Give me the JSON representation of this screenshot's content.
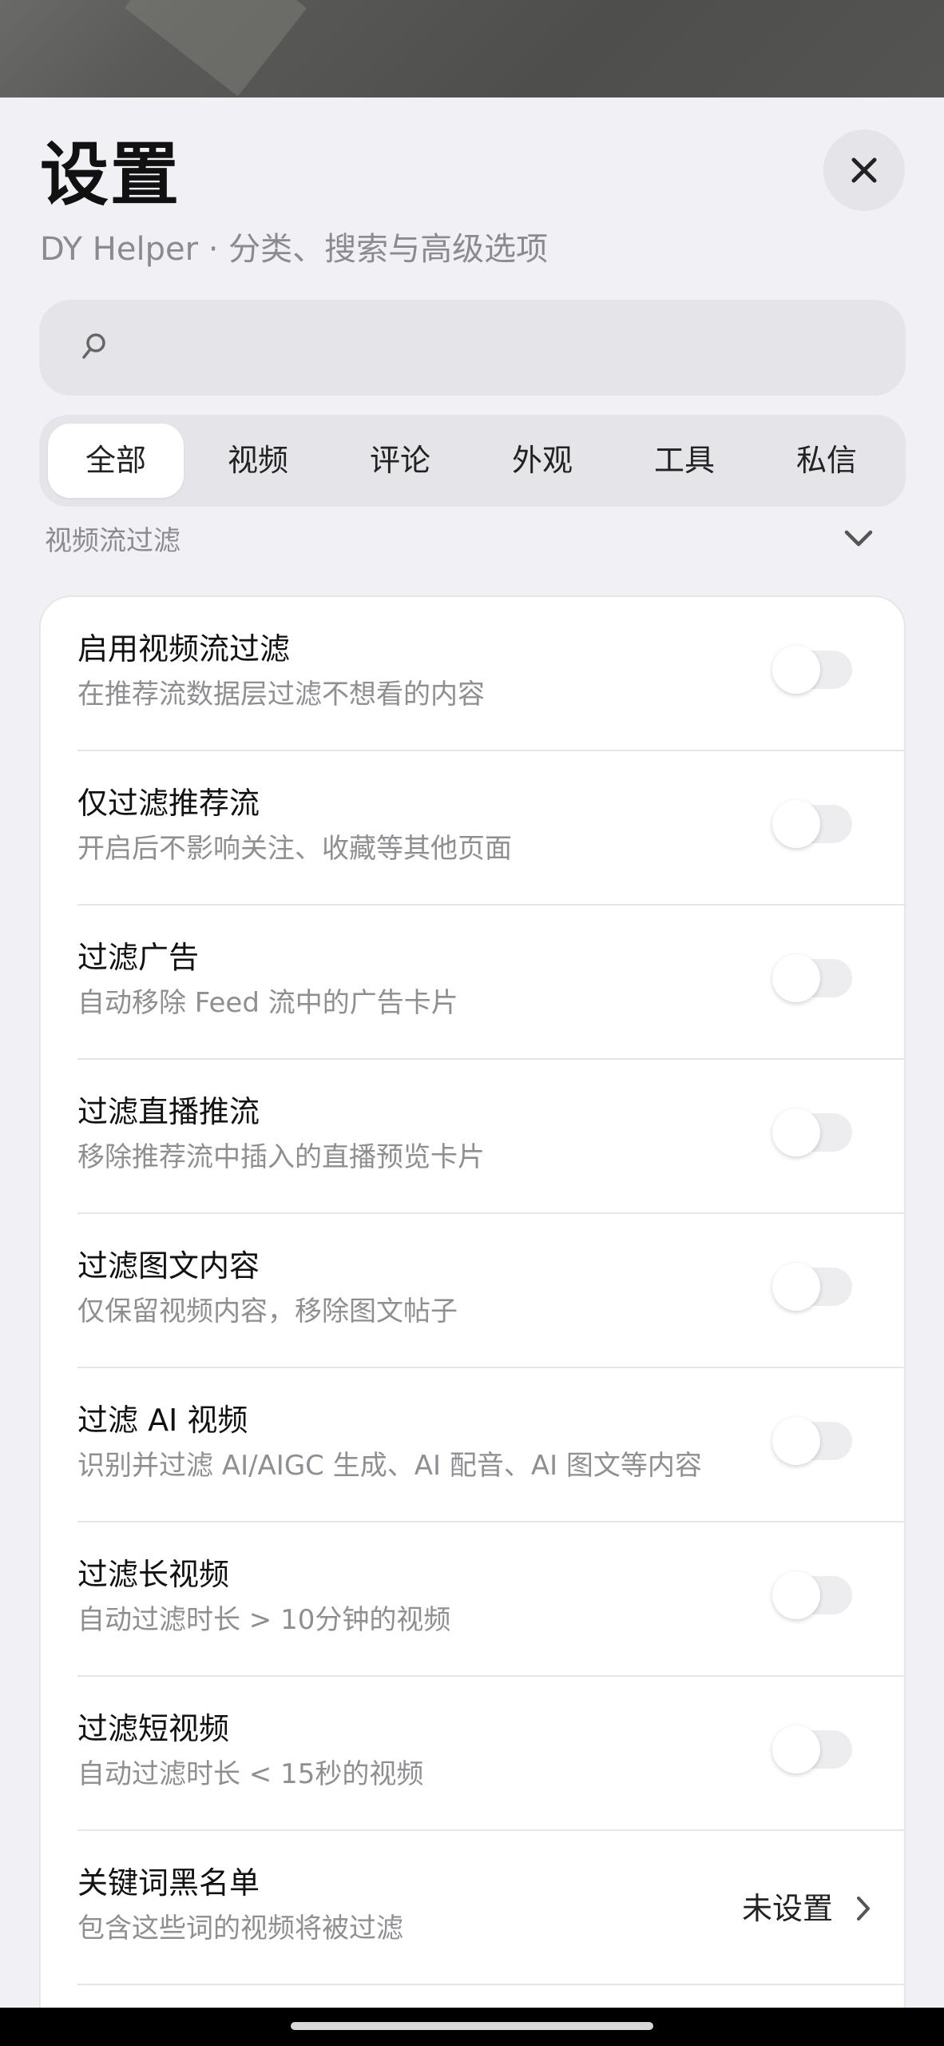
{
  "header": {
    "title": "设置",
    "subtitle": "DY Helper · 分类、搜索与高级选项",
    "close_icon": "close-icon"
  },
  "search": {
    "placeholder": "",
    "value": "",
    "icon": "search-icon"
  },
  "tabs": [
    {
      "label": "全部",
      "active": true
    },
    {
      "label": "视频",
      "active": false
    },
    {
      "label": "评论",
      "active": false
    },
    {
      "label": "外观",
      "active": false
    },
    {
      "label": "工具",
      "active": false
    },
    {
      "label": "私信",
      "active": false
    }
  ],
  "section": {
    "title": "视频流过滤",
    "expanded": true
  },
  "settings": [
    {
      "title": "启用视频流过滤",
      "desc": "在推荐流数据层过滤不想看的内容",
      "enabled": false
    },
    {
      "title": "仅过滤推荐流",
      "desc": "开启后不影响关注、收藏等其他页面",
      "enabled": false
    },
    {
      "title": "过滤广告",
      "desc": "自动移除 Feed 流中的广告卡片",
      "enabled": false
    },
    {
      "title": "过滤直播推流",
      "desc": "移除推荐流中插入的直播预览卡片",
      "enabled": false
    },
    {
      "title": "过滤图文内容",
      "desc": "仅保留视频内容，移除图文帖子",
      "enabled": false
    },
    {
      "title": "过滤 AI 视频",
      "desc": "识别并过滤 AI/AIGC 生成、AI 配音、AI 图文等内容",
      "enabled": false
    },
    {
      "title": "过滤长视频",
      "desc": "自动过滤时长 > 10分钟的视频",
      "enabled": false
    },
    {
      "title": "过滤短视频",
      "desc": "自动过滤时长 < 15秒的视频",
      "enabled": false
    },
    {
      "title": "关键词黑名单",
      "desc": "包含这些词的视频将被过滤",
      "value": "未设置"
    }
  ],
  "colors": {
    "background": "#f1f1f5",
    "card": "#ffffff",
    "control_bg": "#e4e4e9",
    "secondary_text": "#8e8e93"
  }
}
